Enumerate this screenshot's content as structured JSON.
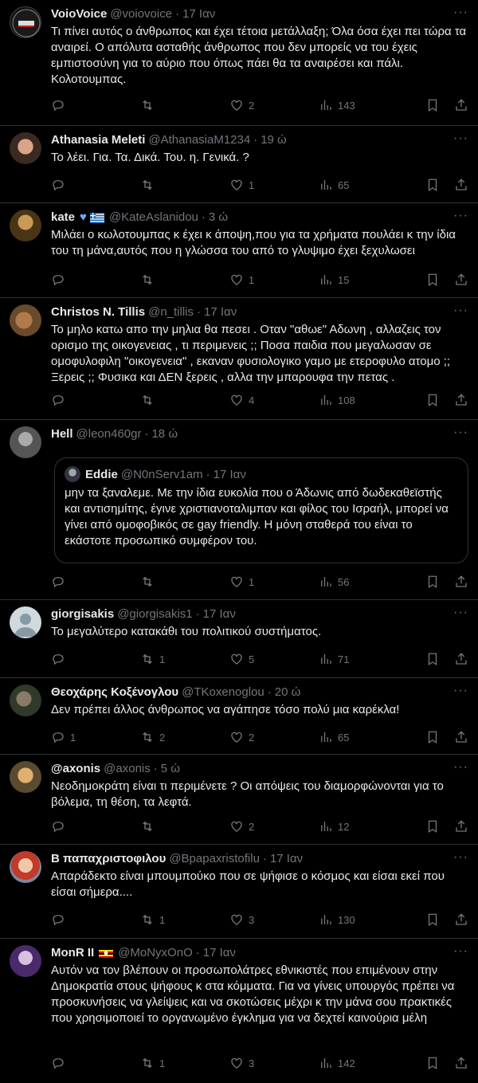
{
  "tweets": [
    {
      "name": "VoioVoice",
      "handle": "@voiovoice",
      "time": "17 Ιαν",
      "text": "Τι πίνει αυτός ο άνθρωπος και έχει τέτοια μετάλλαξη; Όλα όσα έχει πει τώρα τα αναιρεί. Ο απόλυτα ασταθής άνθρωπος που δεν μπορείς να του έχεις εμπιστοσύνη για το αύριο που όπως πάει θα τα αναιρέσει και πάλι. Κολοτουμπας.",
      "replies": "",
      "retweets": "",
      "likes": "2",
      "views": "143"
    },
    {
      "name": "Athanasia Meleti",
      "handle": "@AthanasiaM1234",
      "time": "19 ώ",
      "text": "Το λέει. Για. Τα. Δικά.  Του. η.  Γενικά. ?",
      "replies": "",
      "retweets": "",
      "likes": "1",
      "views": "65"
    },
    {
      "name": "kate",
      "handle": "@KateAslanidou",
      "time": "3 ώ",
      "text": "Μιλάει ο κωλοτουμπας κ έχει κ άποψη,που για τα χρήματα πουλάει κ την ίδια του τη μάνα,αυτός που η γλώσσα του από το γλυψιμο έχει ξεχυλωσει",
      "replies": "",
      "retweets": "",
      "likes": "1",
      "views": "15"
    },
    {
      "name": "Christos N. Tillis",
      "handle": "@n_tillis",
      "time": "17 Ιαν",
      "text": "Το μηλο κατω απο την μηλια θα πεσει . Οταν \"αθωε\" Αδωνη , αλλαζεις τον ορισμο της οικογενειας , τι περιμενεις ;; Ποσα παιδια που μεγαλωσαν σε ομοφυλοφιλη \"οικογενεια\" , εκαναν φυσιολογικο γαμο με ετεροφυλο ατομο ;; Ξερεις ;; Φυσικα και ΔΕΝ ξερεις , αλλα την μπαρουφα την πετας .",
      "replies": "",
      "retweets": "",
      "likes": "4",
      "views": "108"
    },
    {
      "name": "Hell",
      "handle": "@leon460gr",
      "time": "18 ώ",
      "text": "",
      "replies": "",
      "retweets": "",
      "likes": "1",
      "views": "56",
      "quote": {
        "name": "Eddie",
        "handle": "@N0nServ1am",
        "time": "17 Ιαν",
        "text": "μην τα ξαναλεμε. Με την ίδια ευκολία που ο Άδωνις από δωδεκαθεϊστής και αντισημίτης, έγινε χριστιανοταλιμπαν και φίλος του Ισραήλ, μπορεί να γίνει από ομοφοβικός σε gay friendly. Η μόνη σταθερά του είναι το εκάστοτε προσωπικό συμφέρον του."
      }
    },
    {
      "name": "giorgisakis",
      "handle": "@giorgisakis1",
      "time": "17 Ιαν",
      "text": "Το μεγαλύτερο κατακάθι του πολιτικού συστήματος.",
      "replies": "",
      "retweets": "1",
      "likes": "5",
      "views": "71"
    },
    {
      "name": "Θεοχάρης Κοξένογλου",
      "handle": "@TKoxenoglou",
      "time": "20 ώ",
      "text": "Δεν πρέπει άλλος άνθρωπος να αγάπησε τόσο πολύ μια καρέκλα!",
      "replies": "1",
      "retweets": "2",
      "likes": "2",
      "views": "65"
    },
    {
      "name": "@axonis",
      "handle": "@axonis",
      "time": "5 ώ",
      "text": "Νεοδημοκράτη είναι τι περιμένετε ? Οι απόψεις του διαμορφώνονται για το βόλεμα, τη θέση, τα λεφτά.",
      "replies": "",
      "retweets": "",
      "likes": "2",
      "views": "12"
    },
    {
      "name": "Β παπαχριστοφιλου",
      "handle": "@Bpapaxristofilu",
      "time": "17 Ιαν",
      "text": "Απαράδεκτο είναι μπουμπούκο που σε ψήφισε ο κόσμος και είσαι εκεί που είσαι σήμερα....",
      "replies": "",
      "retweets": "1",
      "likes": "3",
      "views": "130"
    },
    {
      "name": "MonR II",
      "handle": "@MoNyxOnO",
      "time": "17 Ιαν",
      "text": "Αυτόν να τον βλέπουν οι προσωπολάτρες εθνικιστές που επιμένουν στην Δημοκρατία στους ψήφους κ στα κόμματα. Για να γίνεις υπουργός πρέπει να προσκυνήσεις να γλείψεις και να σκοτώσεις μέχρι κ την μάνα σου πρακτικές που χρησιμοποιεί το οργανωμένο έγκλημα για να δεχτεί καινούρια μέλη",
      "replies": "",
      "retweets": "1",
      "likes": "3",
      "views": "142"
    }
  ],
  "colors": {
    "bg": "#000000",
    "text": "#e7e9ea",
    "muted": "#71767b",
    "border": "#2f3336"
  }
}
